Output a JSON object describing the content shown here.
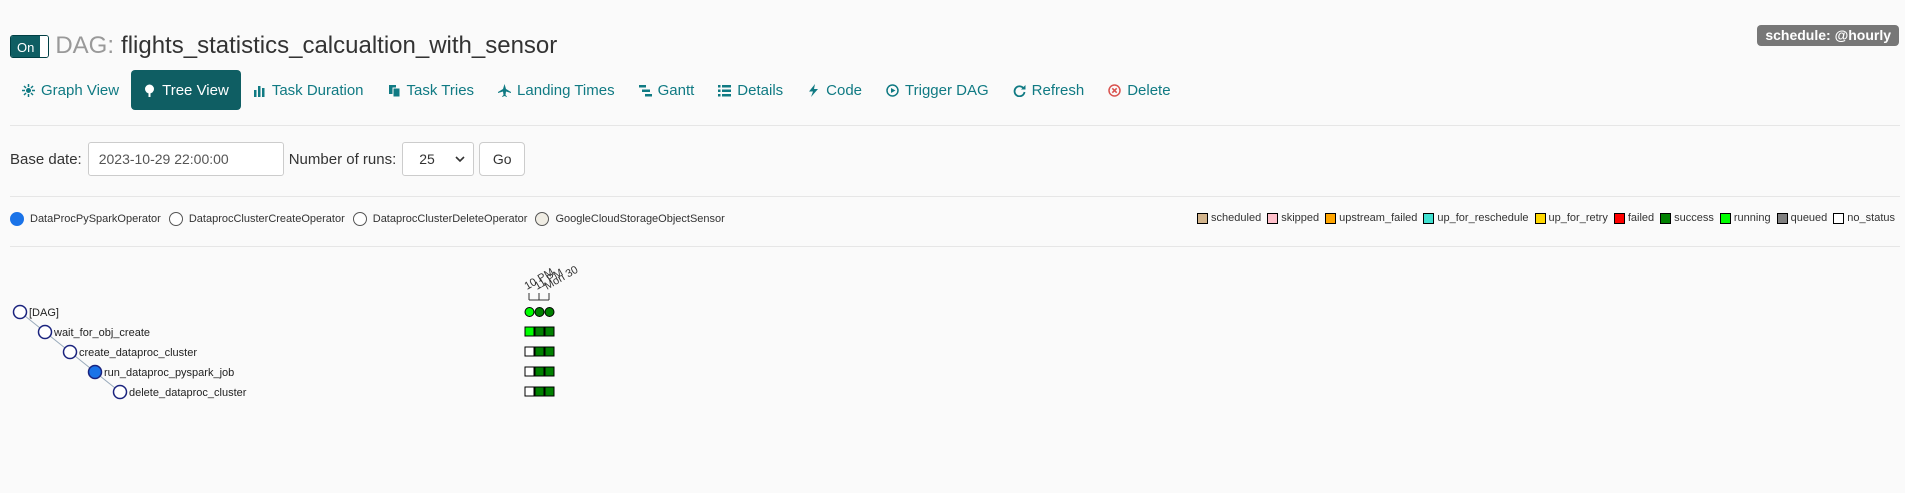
{
  "header": {
    "toggle_label": "On",
    "dag_prefix": "DAG:",
    "dag_name": "flights_statistics_calcualtion_with_sensor",
    "schedule": "schedule: @hourly"
  },
  "nav": [
    {
      "label": "Graph View",
      "icon": "graph-icon",
      "active": false
    },
    {
      "label": "Tree View",
      "icon": "tree-icon",
      "active": true
    },
    {
      "label": "Task Duration",
      "icon": "bar-chart-icon",
      "active": false
    },
    {
      "label": "Task Tries",
      "icon": "copy-icon",
      "active": false
    },
    {
      "label": "Landing Times",
      "icon": "plane-icon",
      "active": false
    },
    {
      "label": "Gantt",
      "icon": "gantt-icon",
      "active": false
    },
    {
      "label": "Details",
      "icon": "list-icon",
      "active": false
    },
    {
      "label": "Code",
      "icon": "flash-icon",
      "active": false
    },
    {
      "label": "Trigger DAG",
      "icon": "play-circle-icon",
      "active": false
    },
    {
      "label": "Refresh",
      "icon": "refresh-icon",
      "active": false
    },
    {
      "label": "Delete",
      "icon": "remove-circle-icon",
      "active": false
    }
  ],
  "form": {
    "base_date_label": "Base date:",
    "base_date_value": "2023-10-29 22:00:00",
    "runs_label": "Number of runs:",
    "runs_value": "25",
    "go_label": "Go"
  },
  "operators": [
    {
      "label": "DataProcPySparkOperator",
      "color": "#1a73e8"
    },
    {
      "label": "DataprocClusterCreateOperator",
      "color": "#ffffff"
    },
    {
      "label": "DataprocClusterDeleteOperator",
      "color": "#ffffff"
    },
    {
      "label": "GoogleCloudStorageObjectSensor",
      "color": "#f0ede4"
    }
  ],
  "states": [
    {
      "label": "scheduled",
      "color": "#d2b48c"
    },
    {
      "label": "skipped",
      "color": "#ffc0cb"
    },
    {
      "label": "upstream_failed",
      "color": "#ffa500"
    },
    {
      "label": "up_for_reschedule",
      "color": "#40e0d0"
    },
    {
      "label": "up_for_retry",
      "color": "#ffd700"
    },
    {
      "label": "failed",
      "color": "#ff0000"
    },
    {
      "label": "success",
      "color": "#008000"
    },
    {
      "label": "running",
      "color": "#00ff00"
    },
    {
      "label": "queued",
      "color": "#808080"
    },
    {
      "label": "no_status",
      "color": "#ffffff"
    }
  ],
  "tree": {
    "run_dates": [
      "10 PM",
      "11 PM",
      "Mon 30"
    ],
    "dag_label": "[DAG]",
    "dag_runs": [
      "#00ff00",
      "#008000",
      "#008000"
    ],
    "tasks": [
      {
        "label": "wait_for_obj_create",
        "depth": 1,
        "operator_color": "#ffffff",
        "instances": [
          "#00ff00",
          "#008000",
          "#008000"
        ]
      },
      {
        "label": "create_dataproc_cluster",
        "depth": 2,
        "operator_color": "#ffffff",
        "instances": [
          "#ffffff",
          "#008000",
          "#008000"
        ]
      },
      {
        "label": "run_dataproc_pyspark_job",
        "depth": 3,
        "operator_color": "#1a73e8",
        "instances": [
          "#ffffff",
          "#008000",
          "#008000"
        ]
      },
      {
        "label": "delete_dataproc_cluster",
        "depth": 4,
        "operator_color": "#ffffff",
        "instances": [
          "#ffffff",
          "#008000",
          "#008000"
        ]
      }
    ]
  }
}
